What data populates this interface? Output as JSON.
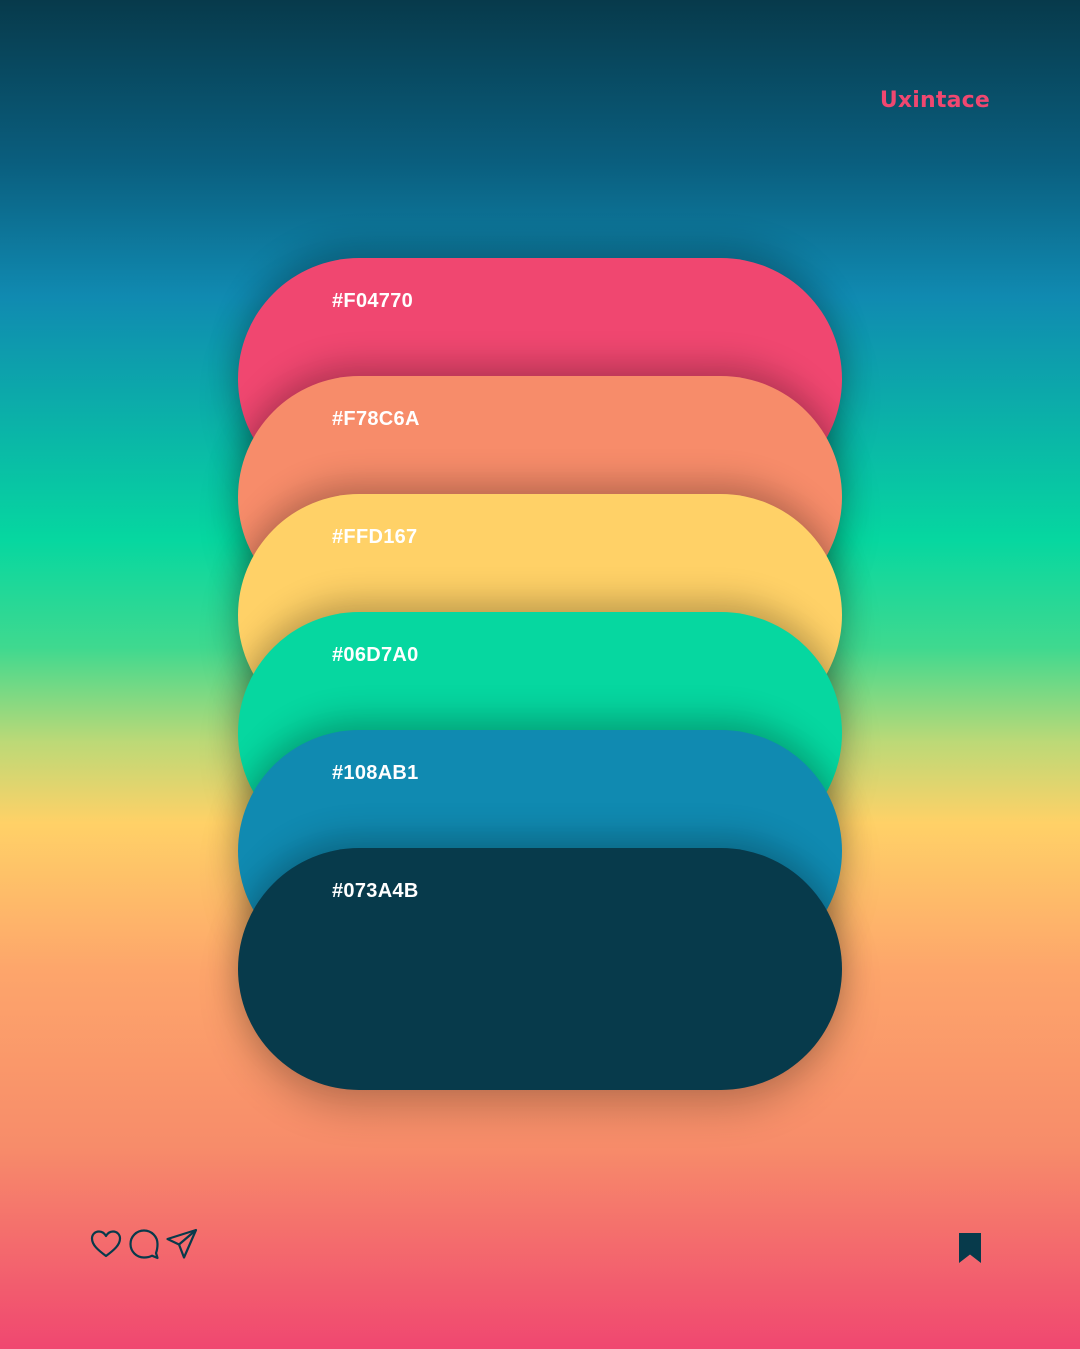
{
  "brand": {
    "name": "Uxintace",
    "color": "#F04770"
  },
  "palette": {
    "swatches": [
      {
        "label": "#F04770",
        "color": "#F04770"
      },
      {
        "label": "#F78C6A",
        "color": "#F78C6A"
      },
      {
        "label": "#FFD167",
        "color": "#FFD167"
      },
      {
        "label": "#06D7A0",
        "color": "#06D7A0"
      },
      {
        "label": "#108AB1",
        "color": "#108AB1"
      },
      {
        "label": "#073A4B",
        "color": "#073A4B"
      }
    ]
  },
  "actions": {
    "icons": [
      "heart-icon",
      "comment-icon",
      "send-icon"
    ],
    "bookmark_icon": "bookmark-icon",
    "icon_color": "#073A4B"
  }
}
